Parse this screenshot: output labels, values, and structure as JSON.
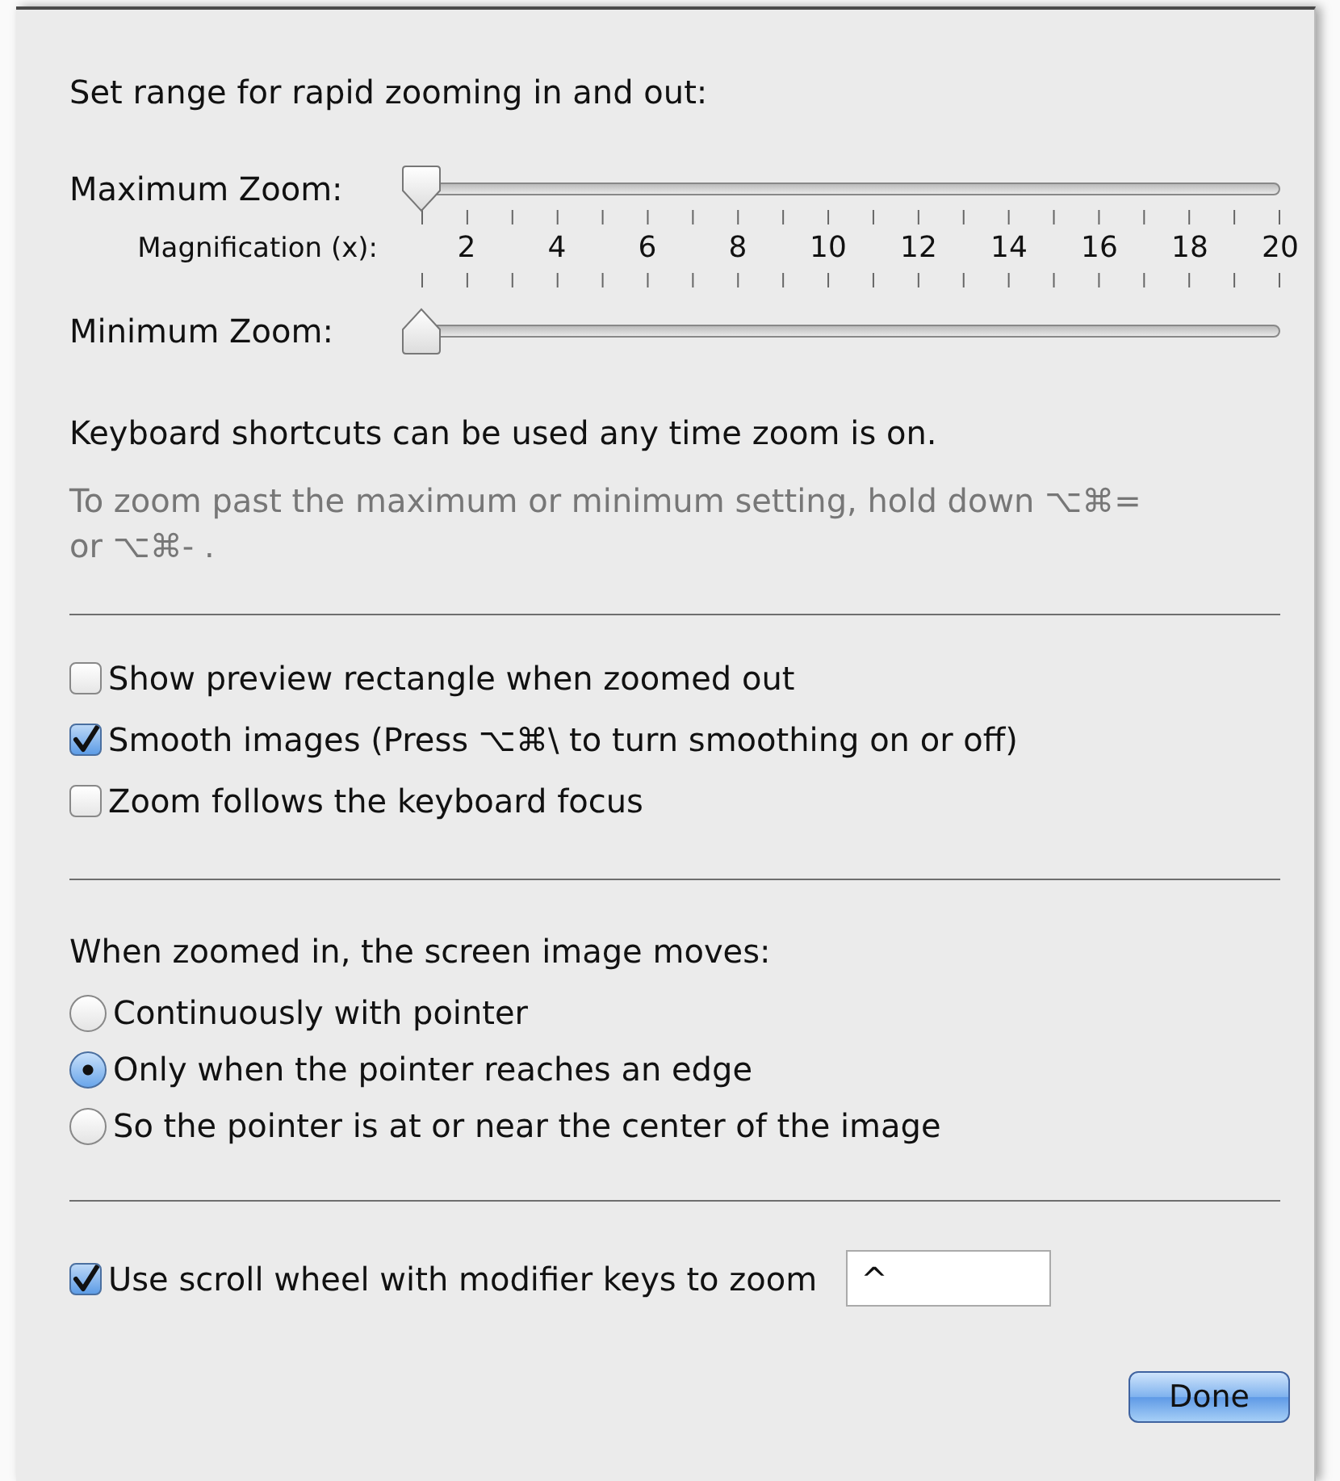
{
  "sheet": {
    "range_heading": "Set range for rapid zooming in and out:",
    "sliders": [
      {
        "label": "Maximum Zoom:",
        "level": 0,
        "kind": "down"
      },
      {
        "label": "Minimum Zoom:",
        "level": 0,
        "kind": "up"
      }
    ],
    "scale": {
      "label": "Magnification (x):",
      "values": [
        "2",
        "4",
        "6",
        "8",
        "10",
        "12",
        "14",
        "16",
        "18",
        "20"
      ]
    },
    "shortcuts_note": "Keyboard shortcuts can be used any time zoom is on.",
    "shortcuts_hint": "To zoom past the maximum or minimum setting, hold down ⌥⌘= or ⌥⌘- .",
    "options": [
      {
        "label": "Show preview rectangle when zoomed out",
        "checked": false
      },
      {
        "label": "Smooth images (Press ⌥⌘\\ to turn smoothing on or off)",
        "checked": true
      },
      {
        "label": "Zoom follows the keyboard focus",
        "checked": false
      }
    ],
    "move_heading": "When zoomed in, the screen image moves:",
    "move_options": [
      {
        "label": "Continuously with pointer",
        "selected": false
      },
      {
        "label": "Only when the pointer reaches an edge",
        "selected": true
      },
      {
        "label": "So the pointer is at or near the center of the image",
        "selected": false
      }
    ],
    "scroll_zoom": {
      "label": "Use scroll wheel with modifier keys to zoom",
      "checked": true,
      "value": "^"
    },
    "done_button": "Done"
  }
}
